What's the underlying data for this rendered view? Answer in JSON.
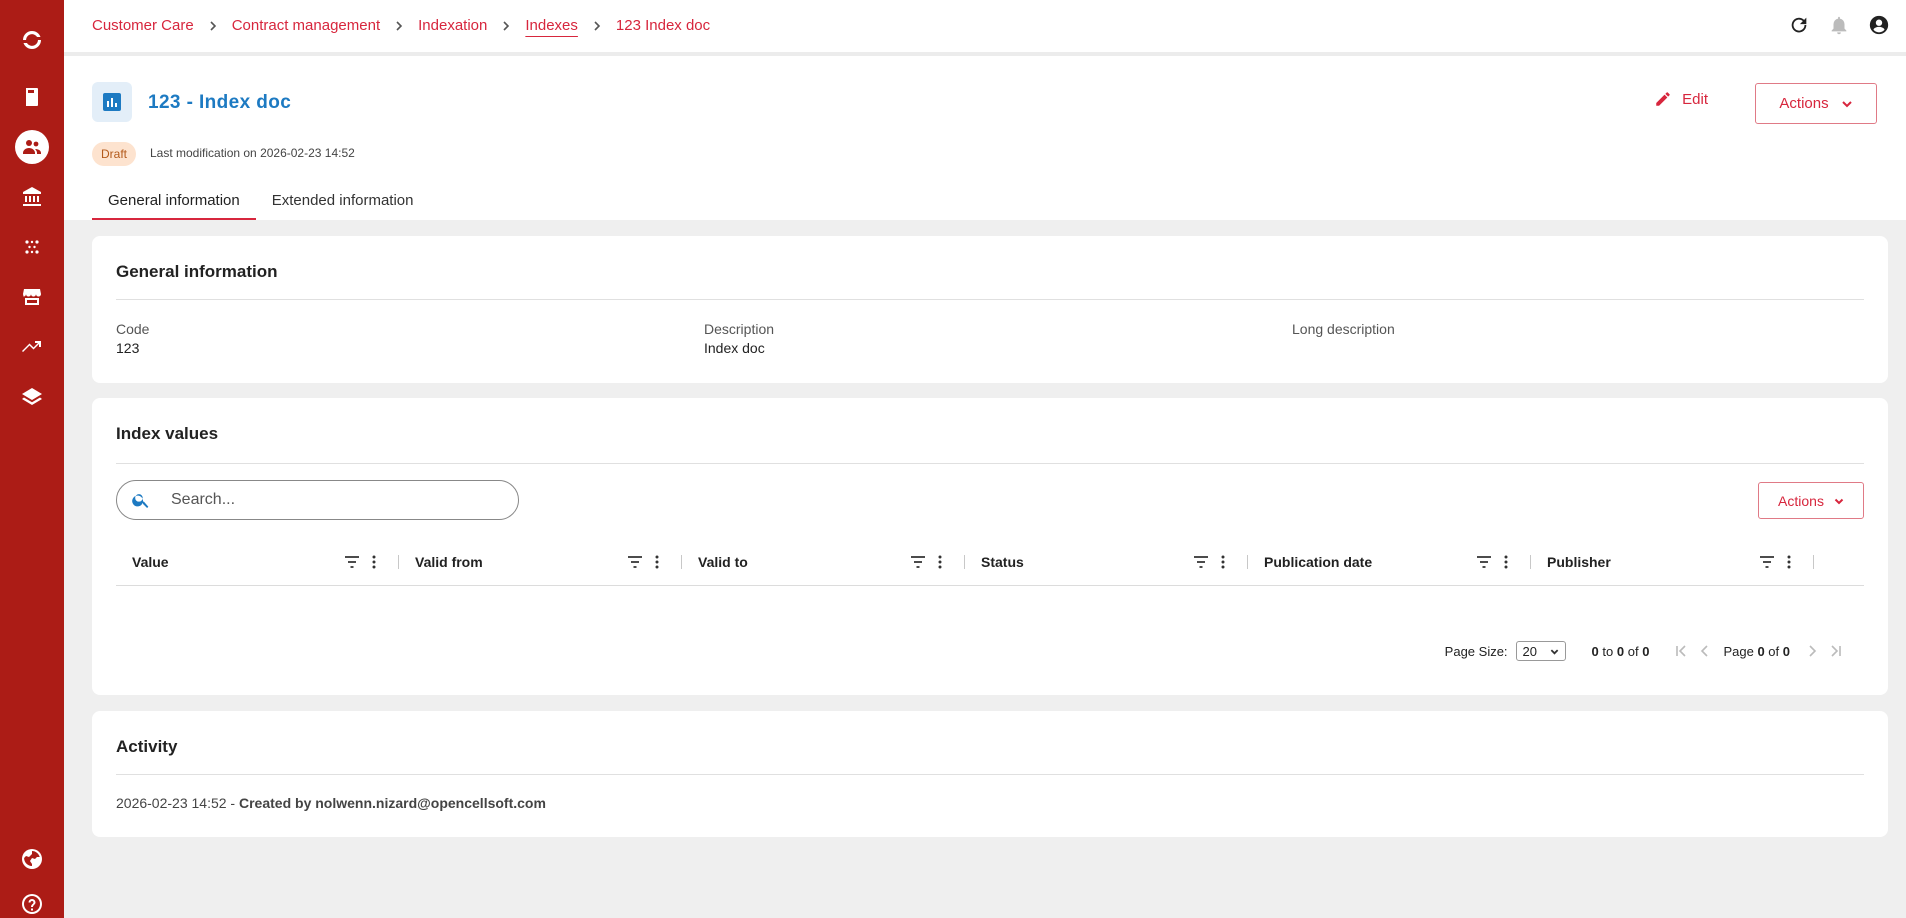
{
  "breadcrumb": [
    {
      "label": "Customer Care"
    },
    {
      "label": "Contract management"
    },
    {
      "label": "Indexation"
    },
    {
      "label": "Indexes"
    },
    {
      "label": "123 Index doc"
    }
  ],
  "header": {
    "title": "123 - Index doc",
    "status_badge": "Draft",
    "last_modification": "Last modification on 2026-02-23 14:52",
    "edit_label": "Edit",
    "actions_label": "Actions"
  },
  "tabs": [
    {
      "label": "General information",
      "active": true
    },
    {
      "label": "Extended information",
      "active": false
    }
  ],
  "general": {
    "title": "General information",
    "code_label": "Code",
    "code_value": "123",
    "description_label": "Description",
    "description_value": "Index doc",
    "long_description_label": "Long description",
    "long_description_value": ""
  },
  "index_values": {
    "title": "Index values",
    "search_placeholder": "Search...",
    "actions_label": "Actions",
    "columns": [
      "Value",
      "Valid from",
      "Valid to",
      "Status",
      "Publication date",
      "Publisher"
    ],
    "pager": {
      "page_size_label": "Page Size:",
      "page_size": "20",
      "range_from": "0",
      "range_to_word": "to",
      "range_to": "0",
      "of_word": "of",
      "total": "0",
      "page_word": "Page",
      "page": "0",
      "page_count": "0"
    }
  },
  "activity": {
    "title": "Activity",
    "entries": [
      {
        "timestamp": "2026-02-23 14:52",
        "separator": " - ",
        "text": "Created by nolwenn.nizard@opencellsoft.com"
      }
    ]
  },
  "colors": {
    "sidebar": "#ac1c16",
    "accent": "#d7263d",
    "title_blue": "#1d7ac2",
    "draft_badge_bg": "#fde3cf"
  },
  "icons": {
    "sidebar": [
      "logo-icon",
      "book-icon",
      "customers-icon",
      "bank-icon",
      "integration-icon",
      "store-icon",
      "trending-icon",
      "layers-icon",
      "language-icon",
      "help-icon"
    ],
    "top": [
      "refresh-icon",
      "bell-icon",
      "account-icon"
    ]
  }
}
